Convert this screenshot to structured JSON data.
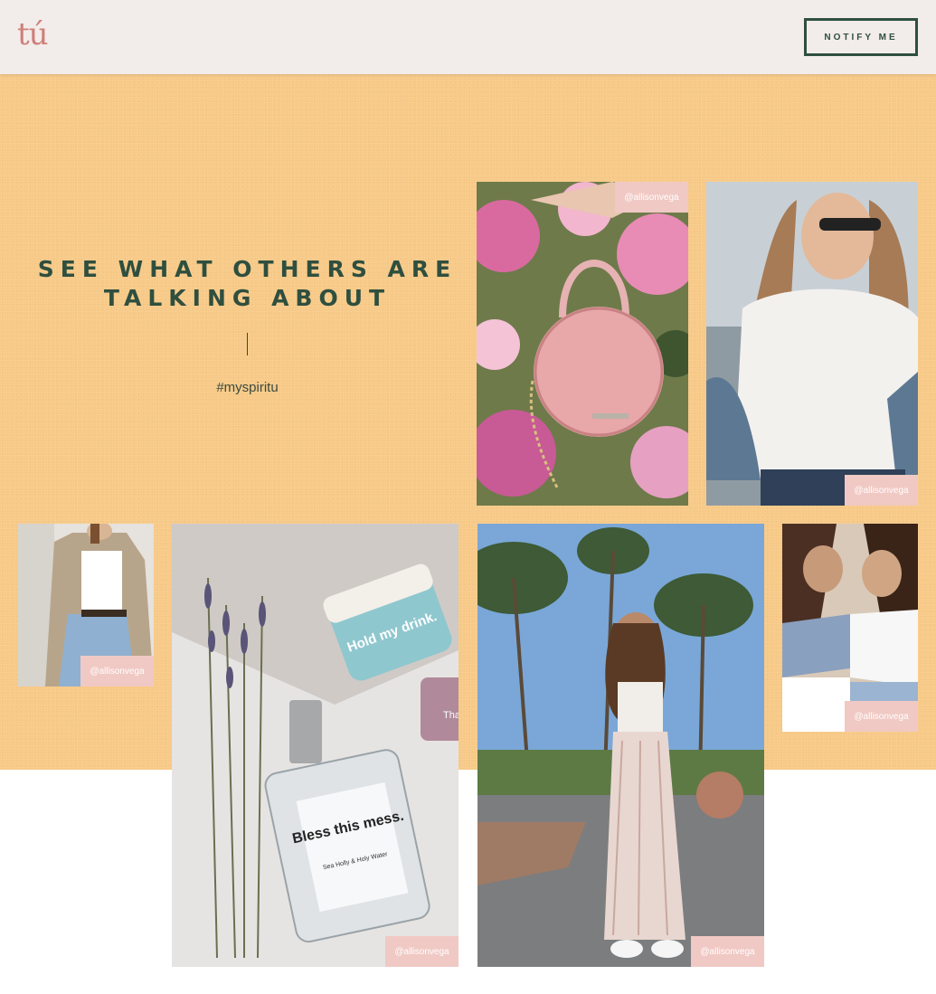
{
  "header": {
    "logo_text": "tú",
    "notify_label": "NOTIFY ME"
  },
  "section": {
    "heading_line1": "SEE WHAT OTHERS ARE",
    "heading_line2": "TALKING ABOUT",
    "hashtag": "#myspiritu"
  },
  "gallery": [
    {
      "handle": "@allisonvega",
      "subject": "pink-round-handbag-photo"
    },
    {
      "handle": "@allisonvega",
      "subject": "woman-white-lace-top-photo"
    },
    {
      "handle": "@allisonvega",
      "subject": "woman-trench-coat-jeans-photo"
    },
    {
      "handle": "@allisonvega",
      "subject": "anese-products-lavender-photo"
    },
    {
      "handle": "@allisonvega",
      "subject": "woman-palm-street-photo"
    },
    {
      "handle": "@allisonvega",
      "subject": "two-friends-laughing-photo"
    }
  ],
  "products": {
    "jar_label": "Hold my drink.",
    "bottle_label": "Bless this mess.",
    "bottle_sub": "Sea Holly & Holy Water",
    "third_label": "That"
  },
  "colors": {
    "band": "#f7c987",
    "header_bg": "#f2ecea",
    "dark_green": "#2f4f3f",
    "logo_pink": "#cf7f78",
    "tag_pink": "#f0c9c4"
  }
}
